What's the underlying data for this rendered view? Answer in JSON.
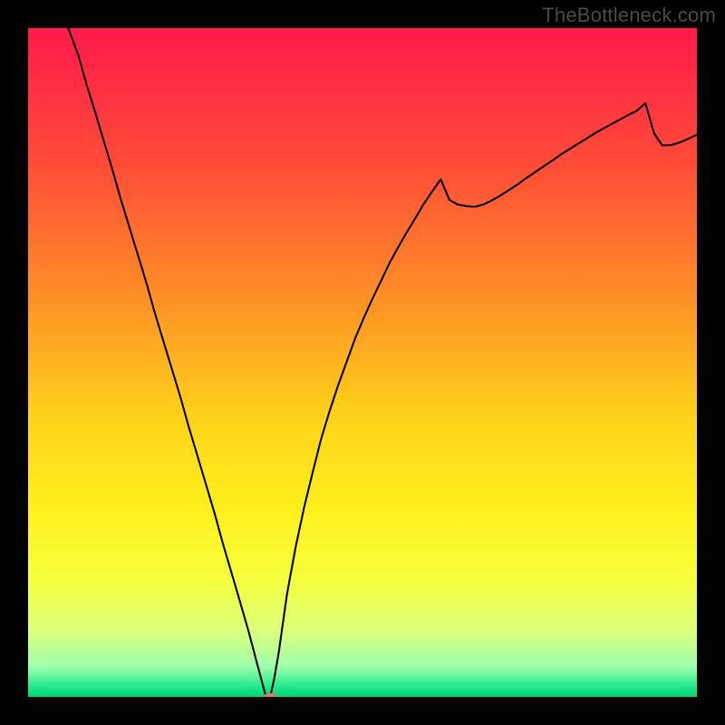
{
  "watermark": "TheBottleneck.com",
  "chart_data": {
    "type": "line",
    "title": "",
    "xlabel": "",
    "ylabel": "",
    "xlim": [
      0,
      100
    ],
    "ylim": [
      0,
      100
    ],
    "grid": false,
    "legend": false,
    "x": [
      6.0,
      7.5,
      8.7,
      10.0,
      11.3,
      12.6,
      13.8,
      15.1,
      16.4,
      17.7,
      18.9,
      20.2,
      21.5,
      22.8,
      24.0,
      25.3,
      26.6,
      27.9,
      29.1,
      30.4,
      31.7,
      33.0,
      34.2,
      35.5,
      36.2,
      36.8,
      37.5,
      38.7,
      40.0,
      41.3,
      42.6,
      43.8,
      45.1,
      46.4,
      47.7,
      48.9,
      50.2,
      51.5,
      52.8,
      54.0,
      55.3,
      56.6,
      57.9,
      59.1,
      60.4,
      61.7,
      63.0,
      64.2,
      65.5,
      66.8,
      68.1,
      69.3,
      70.6,
      71.9,
      73.2,
      74.4,
      75.7,
      77.0,
      78.3,
      79.5,
      80.8,
      82.1,
      83.4,
      84.6,
      85.9,
      87.2,
      88.5,
      89.7,
      91.0,
      92.3,
      93.6,
      94.8,
      96.1,
      97.4,
      98.7,
      100.0
    ],
    "values": [
      100.0,
      95.98,
      91.7,
      87.53,
      83.18,
      78.86,
      74.6,
      70.37,
      66.13,
      61.87,
      57.58,
      53.3,
      49.03,
      44.75,
      40.44,
      36.12,
      31.77,
      27.4,
      23.02,
      18.62,
      14.18,
      9.69,
      5.13,
      0.29,
      0.0,
      2.73,
      6.77,
      15.31,
      22.39,
      28.46,
      33.78,
      38.52,
      42.8,
      46.7,
      50.29,
      53.6,
      56.68,
      59.56,
      62.25,
      64.79,
      67.18,
      69.44,
      71.58,
      73.62,
      75.55,
      77.39,
      74.31,
      73.64,
      73.39,
      73.29,
      73.62,
      74.22,
      74.96,
      75.78,
      76.63,
      77.51,
      78.39,
      79.27,
      80.14,
      80.99,
      81.82,
      82.63,
      83.42,
      84.19,
      84.93,
      85.64,
      86.33,
      86.99,
      87.62,
      88.78,
      84.25,
      82.47,
      82.5,
      82.89,
      83.44,
      84.06
    ],
    "marker": {
      "x": 36.2,
      "y": 0.0,
      "color": "#d97a77",
      "rx": 1.0,
      "ry": 0.6
    },
    "background": {
      "type": "gradient",
      "stops": [
        {
          "offset": 0.0,
          "color": "#ff1a49"
        },
        {
          "offset": 0.2,
          "color": "#ff4b38"
        },
        {
          "offset": 0.4,
          "color": "#ff8e26"
        },
        {
          "offset": 0.58,
          "color": "#ffd21a"
        },
        {
          "offset": 0.72,
          "color": "#fff01c"
        },
        {
          "offset": 0.82,
          "color": "#f6ff3a"
        },
        {
          "offset": 0.9,
          "color": "#ddff7a"
        },
        {
          "offset": 0.955,
          "color": "#9effad"
        },
        {
          "offset": 0.985,
          "color": "#21e98c"
        },
        {
          "offset": 1.0,
          "color": "#00d66f"
        }
      ]
    }
  }
}
